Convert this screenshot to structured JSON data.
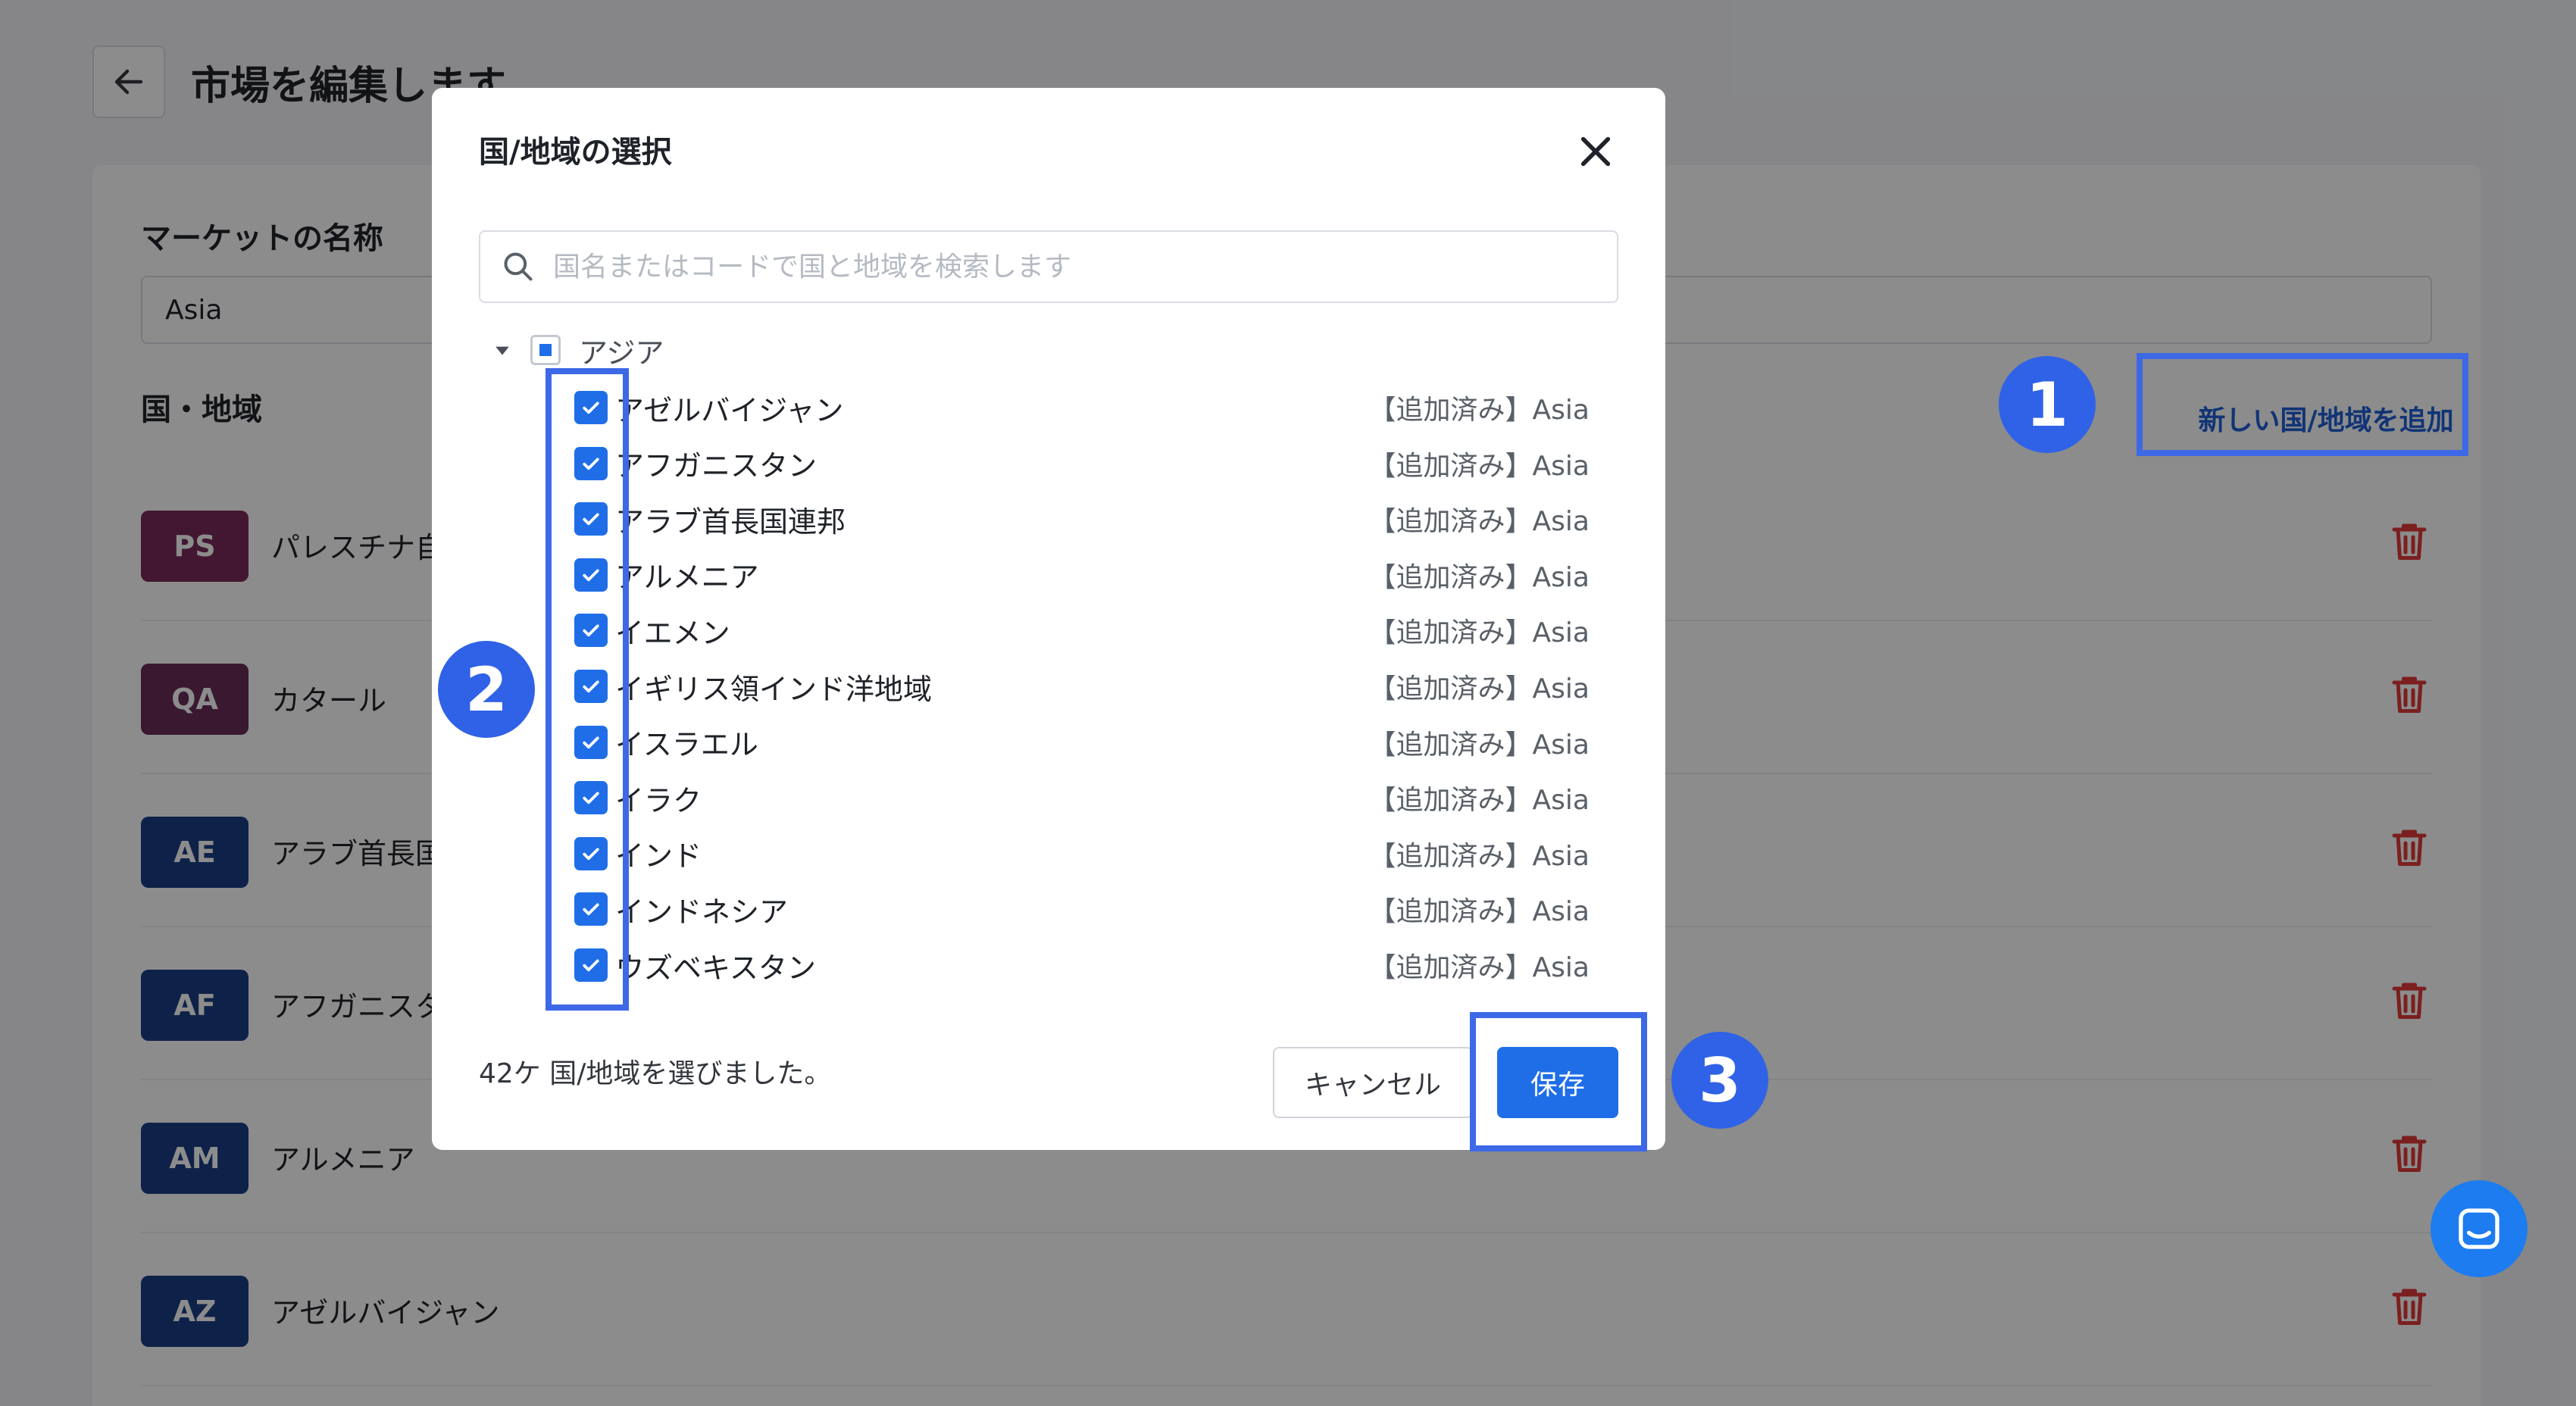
{
  "page": {
    "title": "市場を編集します",
    "market_name_label": "マーケットの名称",
    "market_name_value": "Asia",
    "countries_label": "国・地域",
    "add_country_link": "新しい国/地域を追加",
    "rows": [
      {
        "code": "PS",
        "name": "パレスチナ自",
        "color": "#7a2a5a"
      },
      {
        "code": "QA",
        "name": "カタール",
        "color": "#6a2c58"
      },
      {
        "code": "AE",
        "name": "アラブ首長国",
        "color": "#1b3f86"
      },
      {
        "code": "AF",
        "name": "アフガニスタ",
        "color": "#1b3f86"
      },
      {
        "code": "AM",
        "name": "アルメニア",
        "color": "#1b3f86"
      },
      {
        "code": "AZ",
        "name": "アゼルバイジャン",
        "color": "#1b3f86"
      }
    ]
  },
  "modal": {
    "title": "国/地域の選択",
    "search_placeholder": "国名またはコードで国と地域を検索します",
    "group_label": "アジア",
    "items": [
      {
        "name": "アゼルバイジャン",
        "status": "【追加済み】Asia"
      },
      {
        "name": "アフガニスタン",
        "status": "【追加済み】Asia"
      },
      {
        "name": "アラブ首長国連邦",
        "status": "【追加済み】Asia"
      },
      {
        "name": "アルメニア",
        "status": "【追加済み】Asia"
      },
      {
        "name": "イエメン",
        "status": "【追加済み】Asia"
      },
      {
        "name": "イギリス領インド洋地域",
        "status": "【追加済み】Asia"
      },
      {
        "name": "イスラエル",
        "status": "【追加済み】Asia"
      },
      {
        "name": "イラク",
        "status": "【追加済み】Asia"
      },
      {
        "name": "インド",
        "status": "【追加済み】Asia"
      },
      {
        "name": "インドネシア",
        "status": "【追加済み】Asia"
      },
      {
        "name": "ウズベキスタン",
        "status": "【追加済み】Asia"
      }
    ],
    "selected_count_text": "42ケ 国/地域を選びました。",
    "cancel_label": "キャンセル",
    "save_label": "保存"
  },
  "annotations": {
    "step1": "1",
    "step2": "2",
    "step3": "3"
  },
  "colors": {
    "accent": "#1f6ee8",
    "highlight": "#3d68e6",
    "delete": "#e03a3a"
  }
}
